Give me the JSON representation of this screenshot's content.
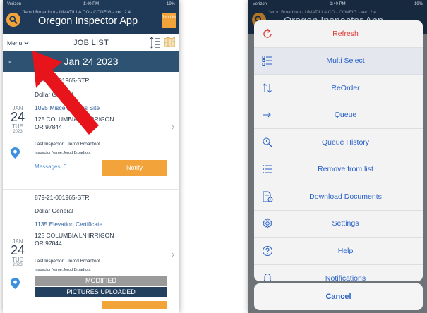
{
  "status": {
    "carrier": "Verizon",
    "time": "1:40 PM",
    "battery": "19%"
  },
  "app": {
    "subtitle": "Jerod Broadfoot - UMATILLA CO - CONFIG - ver: 2.4",
    "title": "Oregon Inspector App",
    "job_list_button": "Job List",
    "logo_icon": "search-logo-icon",
    "brand_color": "#1f3a58",
    "accent_color": "#f2a33a"
  },
  "toolbar": {
    "menu_label": "Menu",
    "title": "JOB LIST"
  },
  "date_banner": {
    "minus": "-",
    "date": "Jan 24 2023"
  },
  "jobs": [
    {
      "number": "879-21-001965-STR",
      "client": "Dollar General",
      "type": "1095 Miscellaneous Site",
      "address_line1": "125 COLUMBIA LN IRRIGON",
      "address_line2": "OR 97844",
      "month": "JAN",
      "day": "24",
      "dow": "TUE",
      "year": "2023",
      "last_inspector_label": "Last Inspector:",
      "last_inspector": "Jerod Broadfoot",
      "inspector_name": "Inspector Name:Jerod Broadfoot",
      "messages": "Messages: 0",
      "notify": "Notify"
    },
    {
      "number": "879-21-001965-STR",
      "client": "Dollar General",
      "type": "1135 Elevation Certificate",
      "address_line1": "125 COLUMBIA LN IRRIGON",
      "address_line2": "OR 97844",
      "month": "JAN",
      "day": "24",
      "dow": "TUE",
      "year": "2023",
      "last_inspector_label": "Last Inspector:",
      "last_inspector": "Jerod Broadfoot",
      "inspector_name": "Inspector Name:Jerod Broadfoot",
      "status_modified": "MODIFIED",
      "status_pictures": "PICTURES UPLOADED"
    }
  ],
  "action_sheet": {
    "items": [
      {
        "label": "Refresh",
        "icon": "refresh-icon"
      },
      {
        "label": "Multi Select",
        "icon": "multi-select-icon"
      },
      {
        "label": "ReOrder",
        "icon": "reorder-icon"
      },
      {
        "label": "Queue",
        "icon": "queue-icon"
      },
      {
        "label": "Queue History",
        "icon": "queue-history-icon"
      },
      {
        "label": "Remove from list",
        "icon": "remove-list-icon"
      },
      {
        "label": "Download Documents",
        "icon": "download-documents-icon"
      },
      {
        "label": "Settings",
        "icon": "settings-icon"
      },
      {
        "label": "Help",
        "icon": "help-icon"
      },
      {
        "label": "Notifications",
        "icon": "notifications-icon"
      }
    ],
    "cancel_label": "Cancel",
    "danger_color": "#e0403c",
    "action_color": "#2a62c6"
  }
}
